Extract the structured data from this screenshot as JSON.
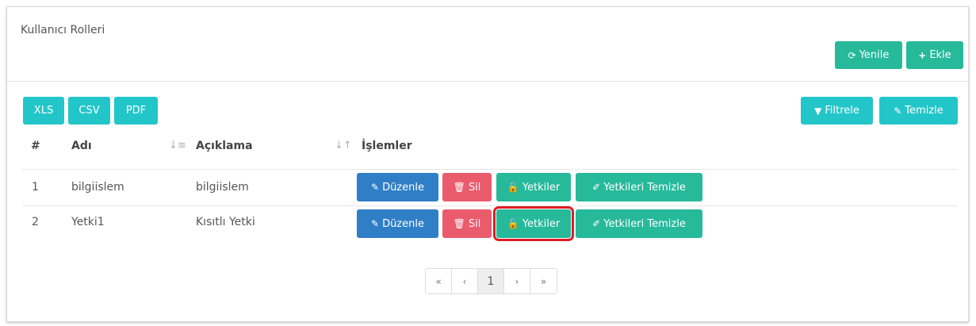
{
  "panel": {
    "title": "Kullanıcı Rolleri"
  },
  "header_actions": {
    "refresh_label": "Yenile",
    "add_label": "Ekle"
  },
  "export": {
    "xls": "XLS",
    "csv": "CSV",
    "pdf": "PDF"
  },
  "filter": {
    "filter_label": "Filtrele",
    "clear_label": "Temizle"
  },
  "table": {
    "columns": [
      "#",
      "Adı",
      "Açıklama",
      "İşlemler"
    ],
    "rows": [
      {
        "num": "1",
        "name": "bilgiislem",
        "desc": "bilgiislem"
      },
      {
        "num": "2",
        "name": "Yetki1",
        "desc": "Kısıtlı Yetki"
      }
    ],
    "actions": {
      "edit": "Düzenle",
      "delete": "Sil",
      "permissions": "Yetkiler",
      "clear_permissions": "Yetkileri Temizle"
    }
  },
  "pagination": {
    "first": "«",
    "prev": "‹",
    "current": "1",
    "next": "›",
    "last": "»"
  },
  "colors": {
    "green": "#26b99a",
    "teal": "#23c6c8",
    "blue": "#2f7fc6",
    "red": "#ea5b6c",
    "highlight": "#e01b24"
  }
}
